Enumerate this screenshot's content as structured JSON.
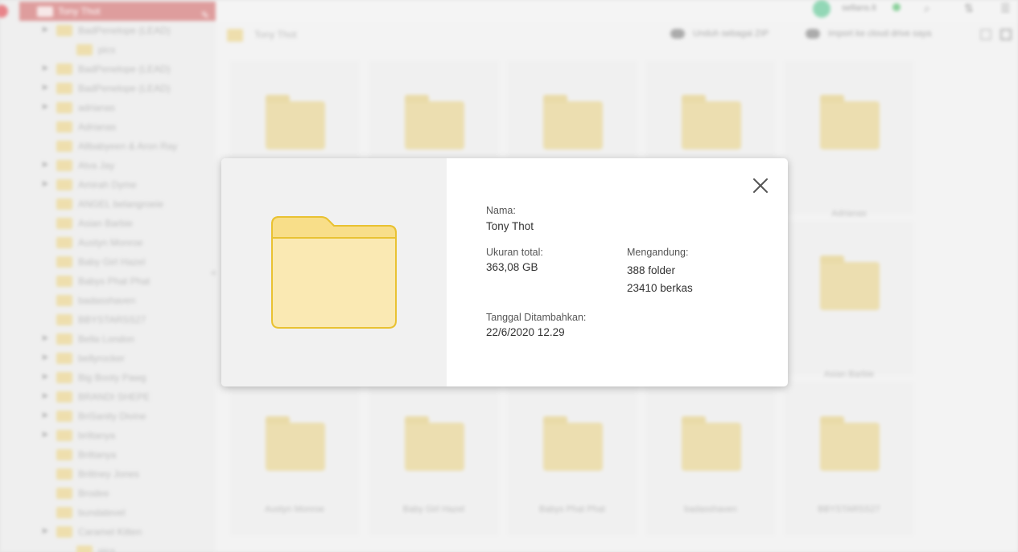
{
  "sidebar": {
    "root_label": "Tony Thot",
    "items": [
      {
        "label": "BadPenelope (LEAD)",
        "expand": true
      },
      {
        "label": "pics",
        "expand": false,
        "sub": true
      },
      {
        "label": "BadPenelope (LEAD)",
        "expand": true
      },
      {
        "label": "BadPenelope (LEAD)",
        "expand": true
      },
      {
        "label": "adrianas",
        "expand": true
      },
      {
        "label": "Adrianas",
        "expand": false
      },
      {
        "label": "Allbabyeen & Aron Ray",
        "expand": false
      },
      {
        "label": "Alva Jay",
        "expand": true
      },
      {
        "label": "Amirah Dyme",
        "expand": true
      },
      {
        "label": "ANGEL belangroeie",
        "expand": false
      },
      {
        "label": "Asian Barbie",
        "expand": false
      },
      {
        "label": "Austyn Monroe",
        "expand": false
      },
      {
        "label": "Baby Girl Hazel",
        "expand": false
      },
      {
        "label": "Babys Phat Phat",
        "expand": false
      },
      {
        "label": "badasshaven",
        "expand": false
      },
      {
        "label": "BBYSTARSS27",
        "expand": false
      },
      {
        "label": "Bella London",
        "expand": true
      },
      {
        "label": "bellyrocker",
        "expand": true
      },
      {
        "label": "Big Booty Pawg",
        "expand": true
      },
      {
        "label": "BRANDI SHEPE",
        "expand": true
      },
      {
        "label": "BriSanity Divine",
        "expand": true
      },
      {
        "label": "brittanya",
        "expand": true
      },
      {
        "label": "Brittanya",
        "expand": false
      },
      {
        "label": "Brittney Jones",
        "expand": false
      },
      {
        "label": "Brodee",
        "expand": false
      },
      {
        "label": "bundatevel",
        "expand": false
      },
      {
        "label": "Caramel Kitten",
        "expand": true
      },
      {
        "label": "pics",
        "expand": false,
        "sub": true
      }
    ]
  },
  "topbar": {
    "user_name": "sellans.lt"
  },
  "toolbar": {
    "folder_title": "Tony Thot",
    "download_zip": "Unduh sebagai ZIP",
    "import_cloud": "Import ke cloud drive saya"
  },
  "grid": {
    "row1": [
      "",
      "",
      "",
      "",
      "",
      ""
    ],
    "row2_right": [
      "Adrianas"
    ],
    "row3_right": [
      "Asian Barbie"
    ],
    "row4": [
      "Austyn Monroe",
      "Baby Girl Hazel",
      "Babys Phat Phat",
      "badasshaven",
      "BBYSTARSS27"
    ]
  },
  "modal": {
    "name_label": "Nama:",
    "name_value": "Tony Thot",
    "size_label": "Ukuran total:",
    "size_value": "363,08 GB",
    "contains_label": "Mengandung:",
    "contains_folders": "388 folder",
    "contains_files": "23410 berkas",
    "date_label": "Tanggal Ditambahkan:",
    "date_value": "22/6/2020 12.29"
  },
  "colors": {
    "folder_fill": "#FAE9B3",
    "folder_tab": "#F8DE89",
    "folder_stroke": "#E9C232",
    "accent_red": "#C44E4E"
  }
}
